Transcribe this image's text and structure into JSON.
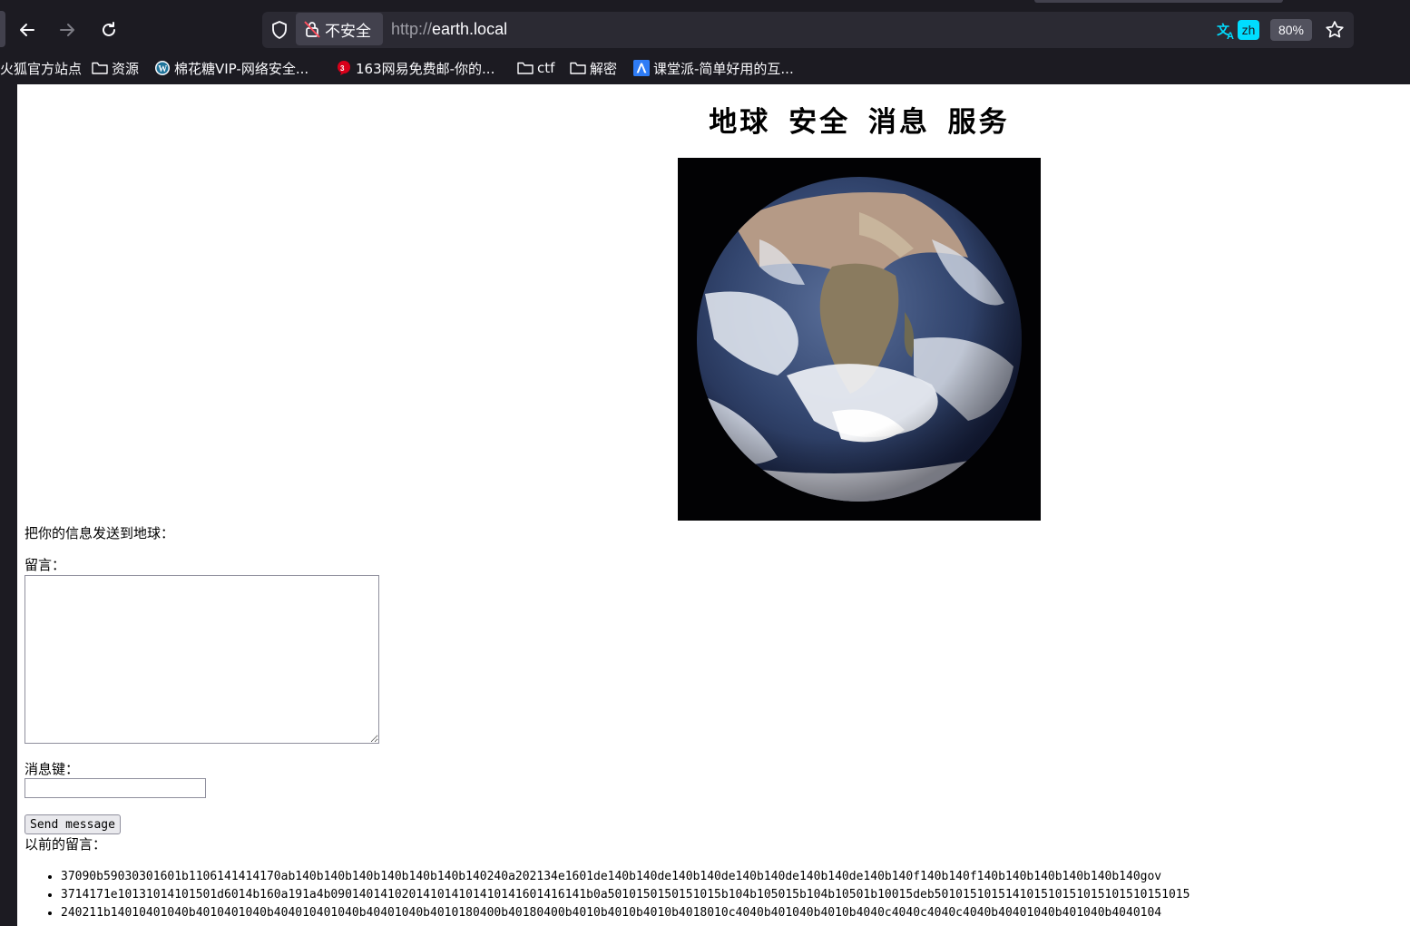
{
  "browser": {
    "insecure_label": "不安全",
    "url_scheme": "http://",
    "url_host": "earth.local",
    "translate_badge": "zh",
    "zoom": "80%",
    "bookmarks": [
      {
        "label": "火狐官方站点",
        "icon": "none"
      },
      {
        "label": "资源",
        "icon": "folder-icon"
      },
      {
        "label": "棉花糖VIP-网络安全...",
        "icon": "wordpress-icon"
      },
      {
        "label": "163网易免费邮-你的...",
        "icon": "netease-mail-icon"
      },
      {
        "label": "ctf",
        "icon": "folder-icon"
      },
      {
        "label": "解密",
        "icon": "folder-icon"
      },
      {
        "label": "课堂派-简单好用的互...",
        "icon": "ketangpai-icon"
      }
    ]
  },
  "page": {
    "title": "地球 安全 消息 服务",
    "send_prompt": "把你的信息发送到地球：",
    "message_label": "留言：",
    "key_label": "消息键：",
    "send_button": "Send message",
    "previous_label": "以前的留言：",
    "previous_messages": [
      "37090b59030301601b1106141414170ab140b140b140b140b140b140b140240a202134e1601de140b140de140b140de140b140de140b140de140b140f140b140f140b140b140b140b140b140gov",
      "3714171e10131014101501d6014b160a191a4b090140141020141014101410141601416141b0a5010150150151015b104b105015b104b10501b10015deb501015101514101510151015101510151015",
      "240211b14010401040b4010401040b404010401040b40401040b4010180400b40180400b4010b4010b4010b4018010c4040b401040b4010b4040c4040c4040c4040b40401040b401040b4040104"
    ]
  },
  "colors": {
    "chrome_bg": "#1c1b22",
    "urlbar_bg": "#2b2a33",
    "accent": "#00ddff"
  }
}
